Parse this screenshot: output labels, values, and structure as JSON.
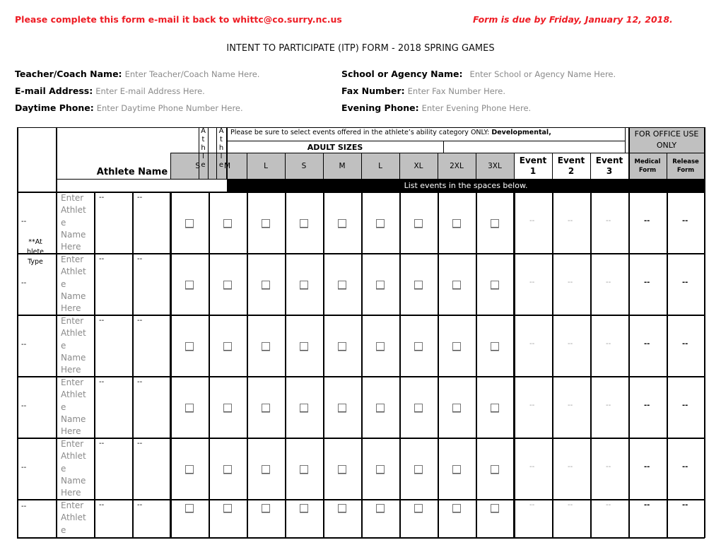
{
  "header": {
    "instruction": "Please complete this form e-mail it back to whittc@co.surry.nc.us",
    "due_date": "Form is due by Friday, January 12, 2018.",
    "title": "INTENT TO PARTICIPATE (ITP) FORM - 2018 SPRING GAMES",
    "colors": {
      "alert": "#ee1c24",
      "placeholder": "#8a8a8a",
      "header_gray": "#c0c0c0"
    }
  },
  "fields": {
    "teacher": {
      "label": "Teacher/Coach Name:",
      "placeholder": "Enter Teacher/Coach Name Here."
    },
    "school": {
      "label": "School or Agency Name:",
      "placeholder": "Enter School or Agency Name Here."
    },
    "email": {
      "label": "E-mail Address:",
      "placeholder": "Enter E-mail Address Here."
    },
    "fax": {
      "label": "Fax Number:",
      "placeholder": "Enter Fax Number Here."
    },
    "day_phone": {
      "label": "Daytime Phone:",
      "placeholder": "Enter Daytime Phone Number Here."
    },
    "eve_phone": {
      "label": "Evening Phone:",
      "placeholder": "Enter Evening Phone Here."
    }
  },
  "table": {
    "athlete_name_header": "Athlete Name",
    "athlete_vertical_1": "A\nt\nh\nl\ne",
    "athlete_vertical_2": "A\nt\nh\nl\ne",
    "notice_prefix": "Please be sure to select events offered in the athlete’s ability category ONLY: ",
    "notice_bold": "Developmental,",
    "adult_sizes": "ADULT SIZES",
    "office_use": "FOR OFFICE USE ONLY",
    "size_headers": [
      "S",
      "M",
      "L",
      "S",
      "M",
      "L",
      "XL",
      "2XL",
      "3XL"
    ],
    "event_headers": [
      "Event\n1",
      "Event\n2",
      "Event\n3"
    ],
    "office_headers": [
      "Medical\nForm",
      "Release\nForm"
    ],
    "list_events_banner": "List events in the spaces below.",
    "athlete_type_note": "**At\nhlete\nType",
    "rows": [
      {
        "type": "--",
        "name_placeholder": "Enter\nAthlet\ne\nName\nHere",
        "col3": "--",
        "col4": "--",
        "events": [
          "--",
          "--",
          "--"
        ],
        "medical": "--",
        "release": "--"
      },
      {
        "type": "--",
        "name_placeholder": "Enter\nAthlet\ne\nName\nHere",
        "col3": "--",
        "col4": "--",
        "events": [
          "--",
          "--",
          "--"
        ],
        "medical": "--",
        "release": "--"
      },
      {
        "type": "--",
        "name_placeholder": "Enter\nAthlet\ne\nName\nHere",
        "col3": "--",
        "col4": "--",
        "events": [
          "--",
          "--",
          "--"
        ],
        "medical": "--",
        "release": "--"
      },
      {
        "type": "--",
        "name_placeholder": "Enter\nAthlet\ne\nName\nHere",
        "col3": "--",
        "col4": "--",
        "events": [
          "--",
          "--",
          "--"
        ],
        "medical": "--",
        "release": "--"
      },
      {
        "type": "--",
        "name_placeholder": "Enter\nAthlet\ne\nName\nHere",
        "col3": "--",
        "col4": "--",
        "events": [
          "--",
          "--",
          "--"
        ],
        "medical": "--",
        "release": "--"
      },
      {
        "type": "--",
        "name_placeholder": "Enter\nAthlet\ne",
        "col3": "--",
        "col4": "--",
        "events": [
          "--",
          "--",
          "--"
        ],
        "medical": "--",
        "release": "--"
      }
    ]
  }
}
